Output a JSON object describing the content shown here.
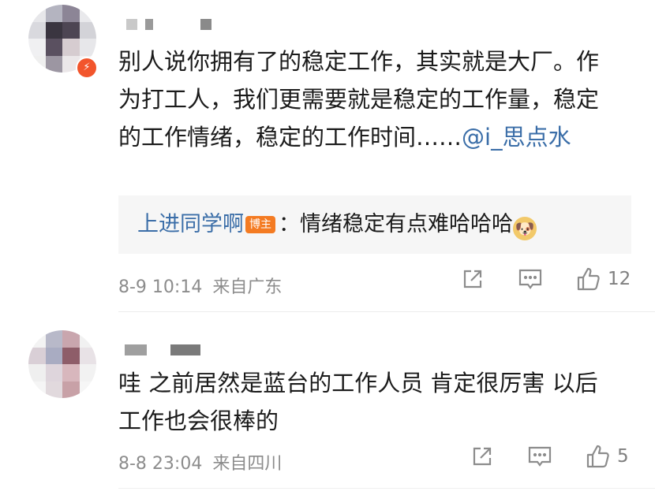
{
  "comments": [
    {
      "text_main": "别人说你拥有了的稳定工作，其实就是大厂。作为打工人，我们更需要就是稳定的工作量，稳定的工作情绪，稳定的工作时间……",
      "mention": "@i_思点水",
      "reply": {
        "user": "上进同学啊",
        "tag": "博主",
        "text": "：情绪稳定有点难哈哈哈",
        "emoji": "🐶"
      },
      "timestamp": "8-9 10:14",
      "location": "来自广东",
      "like_count": "12",
      "badge_icon": "⚡"
    },
    {
      "text_main": "哇 之前居然是蓝台的工作人员 肯定很厉害 以后工作也会很棒的",
      "timestamp": "8-8 23:04",
      "location": "来自四川",
      "like_count": "5"
    }
  ],
  "icons": {
    "share": "share-icon",
    "comment": "comment-icon",
    "like": "thumbs-up-icon"
  },
  "colors": {
    "link": "#3b6ea8",
    "meta": "#8c8c8c",
    "reply_bg": "#f6f6f6",
    "blogger_tag": "#f47b22"
  }
}
